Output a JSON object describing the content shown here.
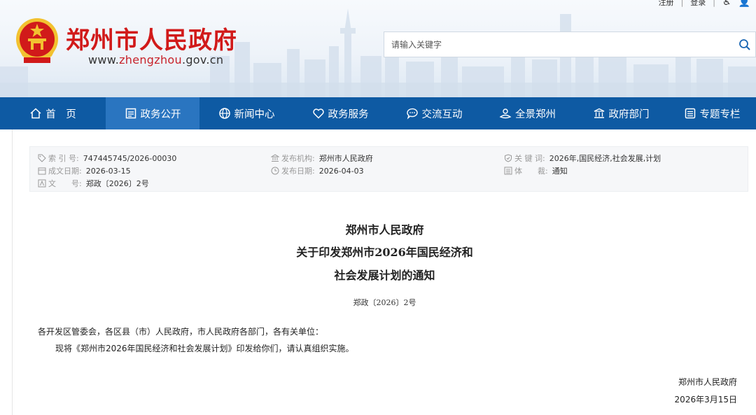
{
  "site": {
    "title": "郑州市人民政府",
    "url_prefix": "www.",
    "url_mid": "zhengzhou",
    "url_suffix": ".gov.cn"
  },
  "toplinks": {
    "register": "注册",
    "login": "登录"
  },
  "search": {
    "placeholder": "请输入关键字"
  },
  "nav": {
    "items": [
      {
        "label": "首　页",
        "icon": "home-icon"
      },
      {
        "label": "政务公开",
        "icon": "document-icon"
      },
      {
        "label": "新闻中心",
        "icon": "globe-icon"
      },
      {
        "label": "政务服务",
        "icon": "heart-icon"
      },
      {
        "label": "交流互动",
        "icon": "chat-icon"
      },
      {
        "label": "全景郑州",
        "icon": "panorama-icon"
      },
      {
        "label": "政府部门",
        "icon": "building-icon"
      },
      {
        "label": "专题专栏",
        "icon": "column-icon"
      }
    ],
    "active_index": 1
  },
  "meta": {
    "index_label": "索 引 号:",
    "index_value": "747445745/2026-00030",
    "date_label": "成文日期:",
    "date_value": "2026-03-15",
    "docno_label": "文　　号:",
    "docno_value": "郑政〔2026〕2号",
    "publisher_label": "发布机构:",
    "publisher_value": "郑州市人民政府",
    "pubdate_label": "发布日期:",
    "pubdate_value": "2026-04-03",
    "keywords_label": "关 键 词:",
    "keywords_value": "2026年,国民经济,社会发展,计划",
    "genre_label": "体　　裁:",
    "genre_value": "通知"
  },
  "doc": {
    "title_line1": "郑州市人民政府",
    "title_line2": "关于印发郑州市2026年国民经济和",
    "title_line3": "社会发展计划的通知",
    "number": "郑政〔2026〕2号",
    "salutation": "各开发区管委会，各区县（市）人民政府，市人民政府各部门，各有关单位：",
    "paragraph": "现将《郑州市2026年国民经济和社会发展计划》印发给你们，请认真组织实施。",
    "signer": "郑州市人民政府",
    "sign_date": "2026年3月15日"
  },
  "colors": {
    "brand_red": "#d11a1a",
    "nav_blue": "#0e5aa3",
    "nav_active": "#2a75c0"
  }
}
